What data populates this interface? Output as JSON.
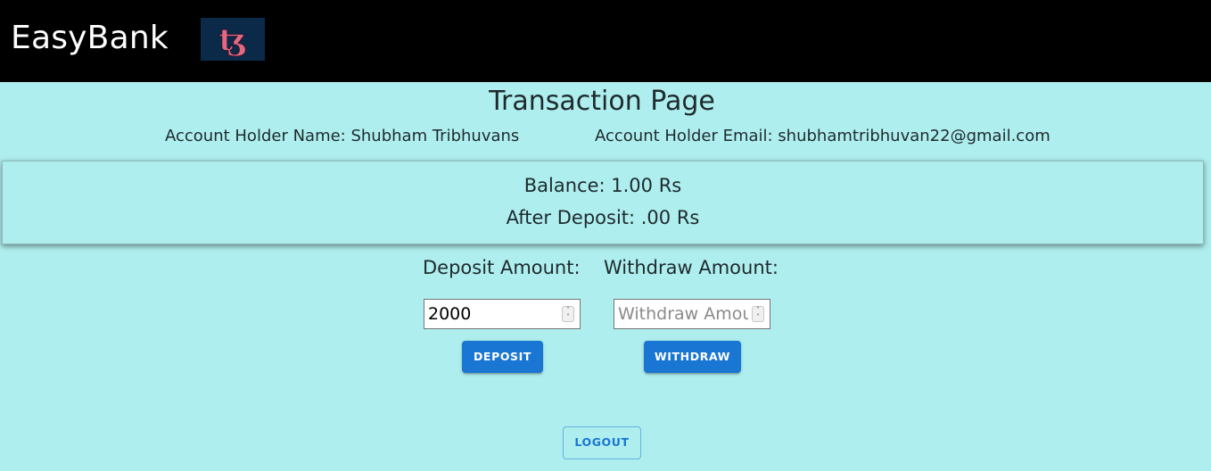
{
  "navbar": {
    "brand": "EasyBank",
    "logo_icon": "tezos-logo-icon",
    "colors": {
      "background": "#000000",
      "brand_text": "#ffffff",
      "logo_bg": "#0b2a4a",
      "logo_glyph": "#e06a86"
    }
  },
  "page": {
    "title": "Transaction Page",
    "background": "#afeeee"
  },
  "account": {
    "name_text": "Account Holder Name: Shubham Tribhuvans",
    "email_text": "Account Holder Email: shubhamtribhuvan22@gmail.com"
  },
  "balance": {
    "balance_text": "Balance: 1.00 Rs",
    "after_deposit_text": "After Deposit: .00 Rs"
  },
  "deposit": {
    "label": "Deposit Amount:",
    "value": "2000",
    "placeholder": "Deposit Amount",
    "button_label": "DEPOSIT"
  },
  "withdraw": {
    "label": "Withdraw Amount:",
    "value": "",
    "placeholder": "Withdraw Amount",
    "button_label": "WITHDRAW"
  },
  "logout": {
    "button_label": "LOGOUT"
  },
  "colors": {
    "primary": "#1976d2"
  }
}
